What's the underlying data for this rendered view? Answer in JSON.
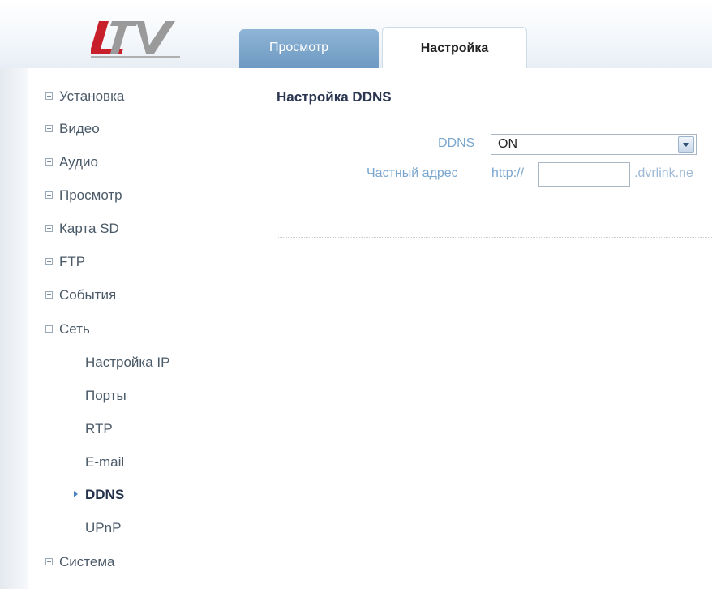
{
  "header": {
    "logo_text": "LTV",
    "tabs": [
      {
        "label": "Просмотр",
        "active": false
      },
      {
        "label": "Настройка",
        "active": true
      }
    ]
  },
  "sidebar": {
    "items": [
      {
        "label": "Установка"
      },
      {
        "label": "Видео"
      },
      {
        "label": "Аудио"
      },
      {
        "label": "Просмотр"
      },
      {
        "label": "Карта SD"
      },
      {
        "label": "FTP"
      },
      {
        "label": "События"
      },
      {
        "label": "Сеть"
      },
      {
        "label": "Система"
      }
    ],
    "network_subitems": [
      {
        "label": "Настройка IP"
      },
      {
        "label": "Порты"
      },
      {
        "label": "RTP"
      },
      {
        "label": "E-mail"
      },
      {
        "label": "DDNS",
        "active": true
      },
      {
        "label": "UPnP"
      }
    ]
  },
  "main": {
    "section_title": "Настройка DDNS",
    "ddns_label": "DDNS",
    "ddns_value": "ON",
    "private_address_label": "Частный адрес",
    "url_prefix": "http://",
    "url_value": "",
    "url_suffix": ".dvrlink.ne"
  },
  "colors": {
    "tab_inactive": "#7ba3c9",
    "label_blue": "#7aa6cf",
    "logo_red": "#c8202a",
    "logo_gray": "#9a9a9a"
  }
}
